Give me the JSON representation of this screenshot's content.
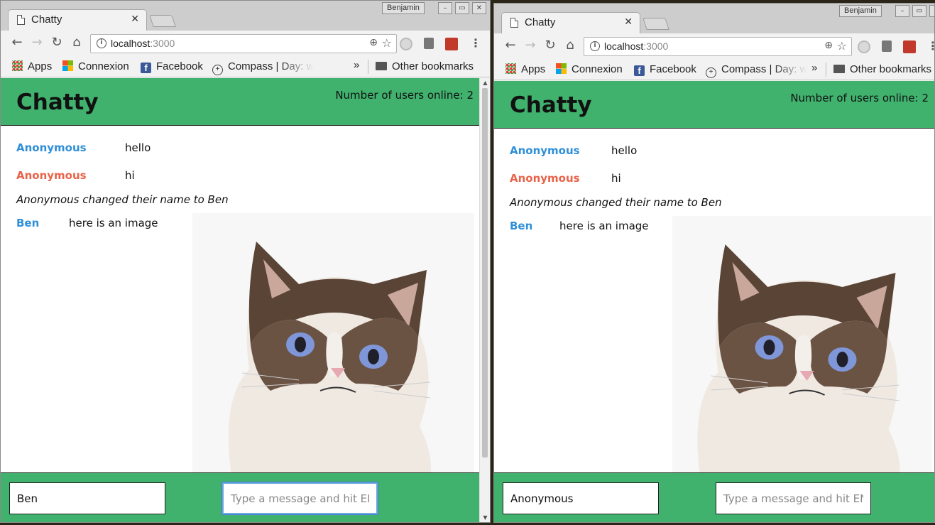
{
  "colors": {
    "navbar_green": "#40b26e",
    "username_blue": "#2f8fd8",
    "username_orange": "#e8634a"
  },
  "profile_name": "Benjamin",
  "tab_title": "Chatty",
  "url": {
    "host": "localhost",
    "port": ":3000"
  },
  "bookmarks": {
    "apps": "Apps",
    "connexion": "Connexion",
    "facebook": "Facebook",
    "compass": "Compass | Day: w",
    "overflow": "»",
    "other": "Other bookmarks"
  },
  "app": {
    "brand": "Chatty",
    "online_count": "Number of users online: 2",
    "placeholder": "Type a message and hit ENTER",
    "messages": [
      {
        "user": "Anonymous",
        "text": "hello",
        "color": "#2f8fd8"
      },
      {
        "user": "Anonymous",
        "text": "hi",
        "color": "#e8634a"
      },
      {
        "system": "Anonymous changed their name to Ben"
      },
      {
        "user": "Ben",
        "text": "here is an image",
        "color": "#2f8fd8",
        "image": "grumpy-cat"
      }
    ]
  },
  "left_window": {
    "username_value": "Ben"
  },
  "right_window": {
    "username_value": "Anonymous"
  }
}
